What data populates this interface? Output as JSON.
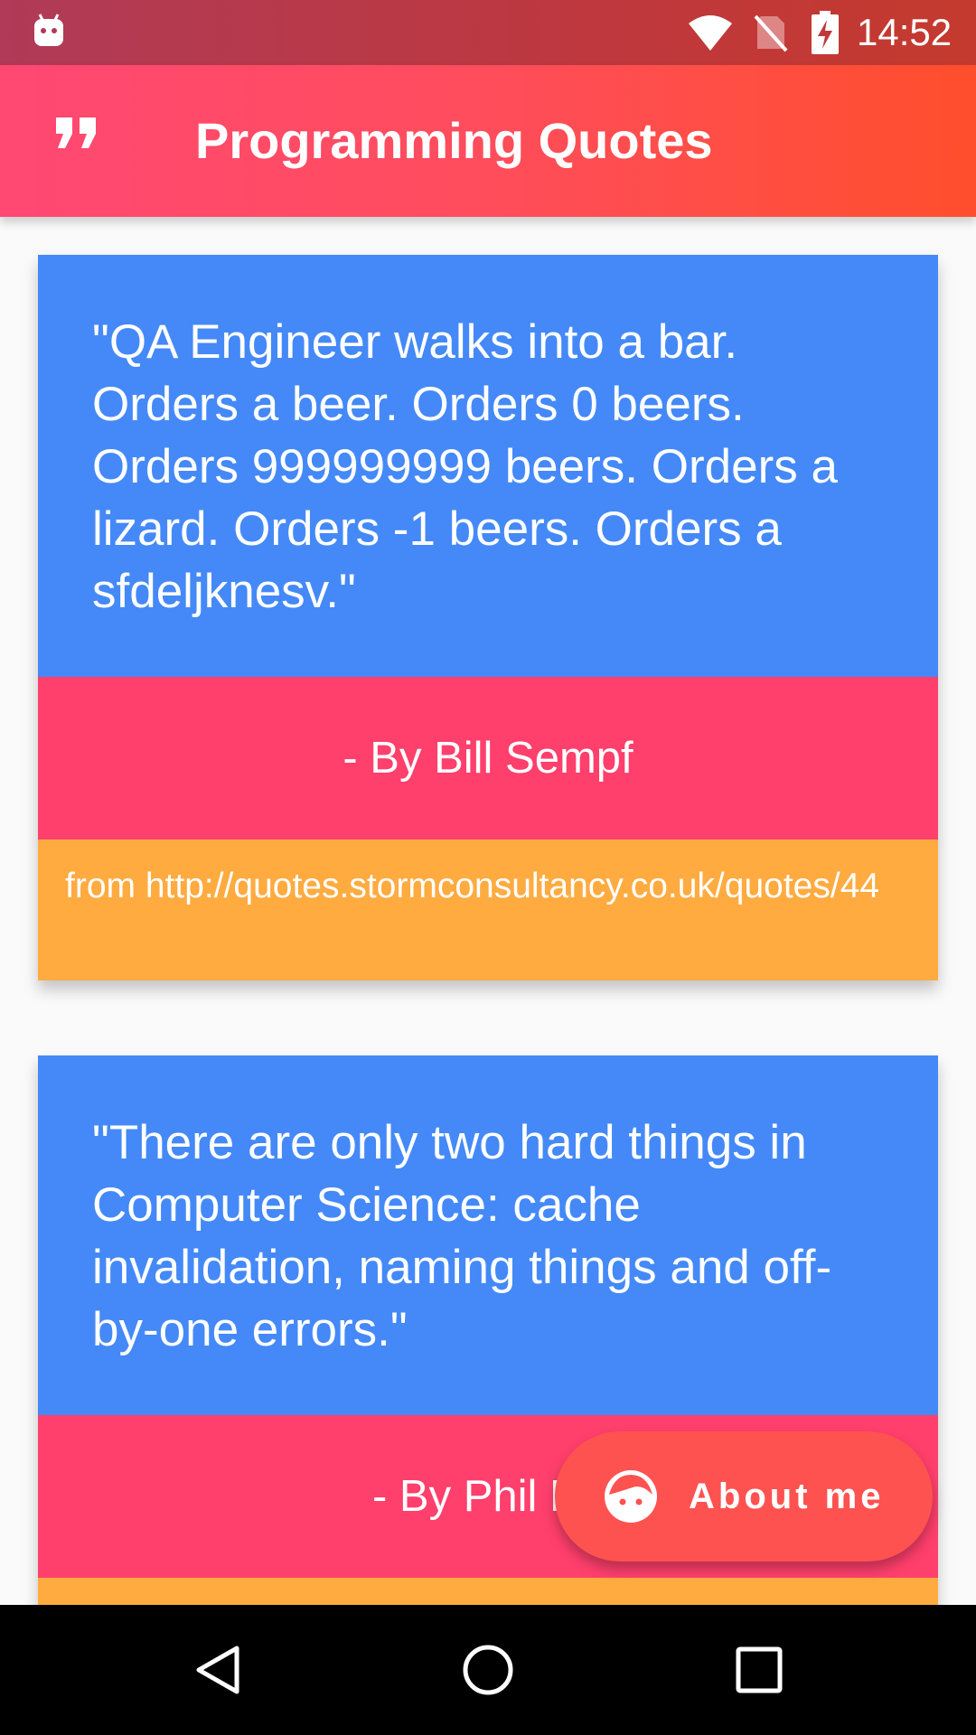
{
  "status_bar": {
    "time": "14:52",
    "icons": [
      "android-robot-icon",
      "wifi-icon",
      "no-sim-icon",
      "battery-charging-icon"
    ]
  },
  "app_bar": {
    "icon": "format-quote-icon",
    "title": "Programming Quotes"
  },
  "quotes": [
    {
      "text": "\"QA Engineer walks into a bar. Orders a beer. Orders 0 beers. Orders 999999999 beers. Orders a lizard. Orders -1 beers. Orders a sfdeljknesv.\"",
      "author": "- By Bill Sempf",
      "source": "from http://quotes.stormconsultancy.co.uk/quotes/44"
    },
    {
      "text": "\"There are only two hard things in Computer Science: cache invalidation, naming things and off-by-one errors.\"",
      "author": "- By Phil Ka"
    }
  ],
  "fab": {
    "icon": "face-icon",
    "label": "About me"
  },
  "nav_bar": {
    "icons": [
      "back-icon",
      "home-icon",
      "recents-icon"
    ]
  },
  "colors": {
    "quote_bg": "#4489f7",
    "author_bg": "#ff3f6c",
    "source_bg": "#ffab40",
    "fab_bg": "#fe5251",
    "app_bar_start": "#ff4873",
    "app_bar_end": "#ff4e2c"
  }
}
